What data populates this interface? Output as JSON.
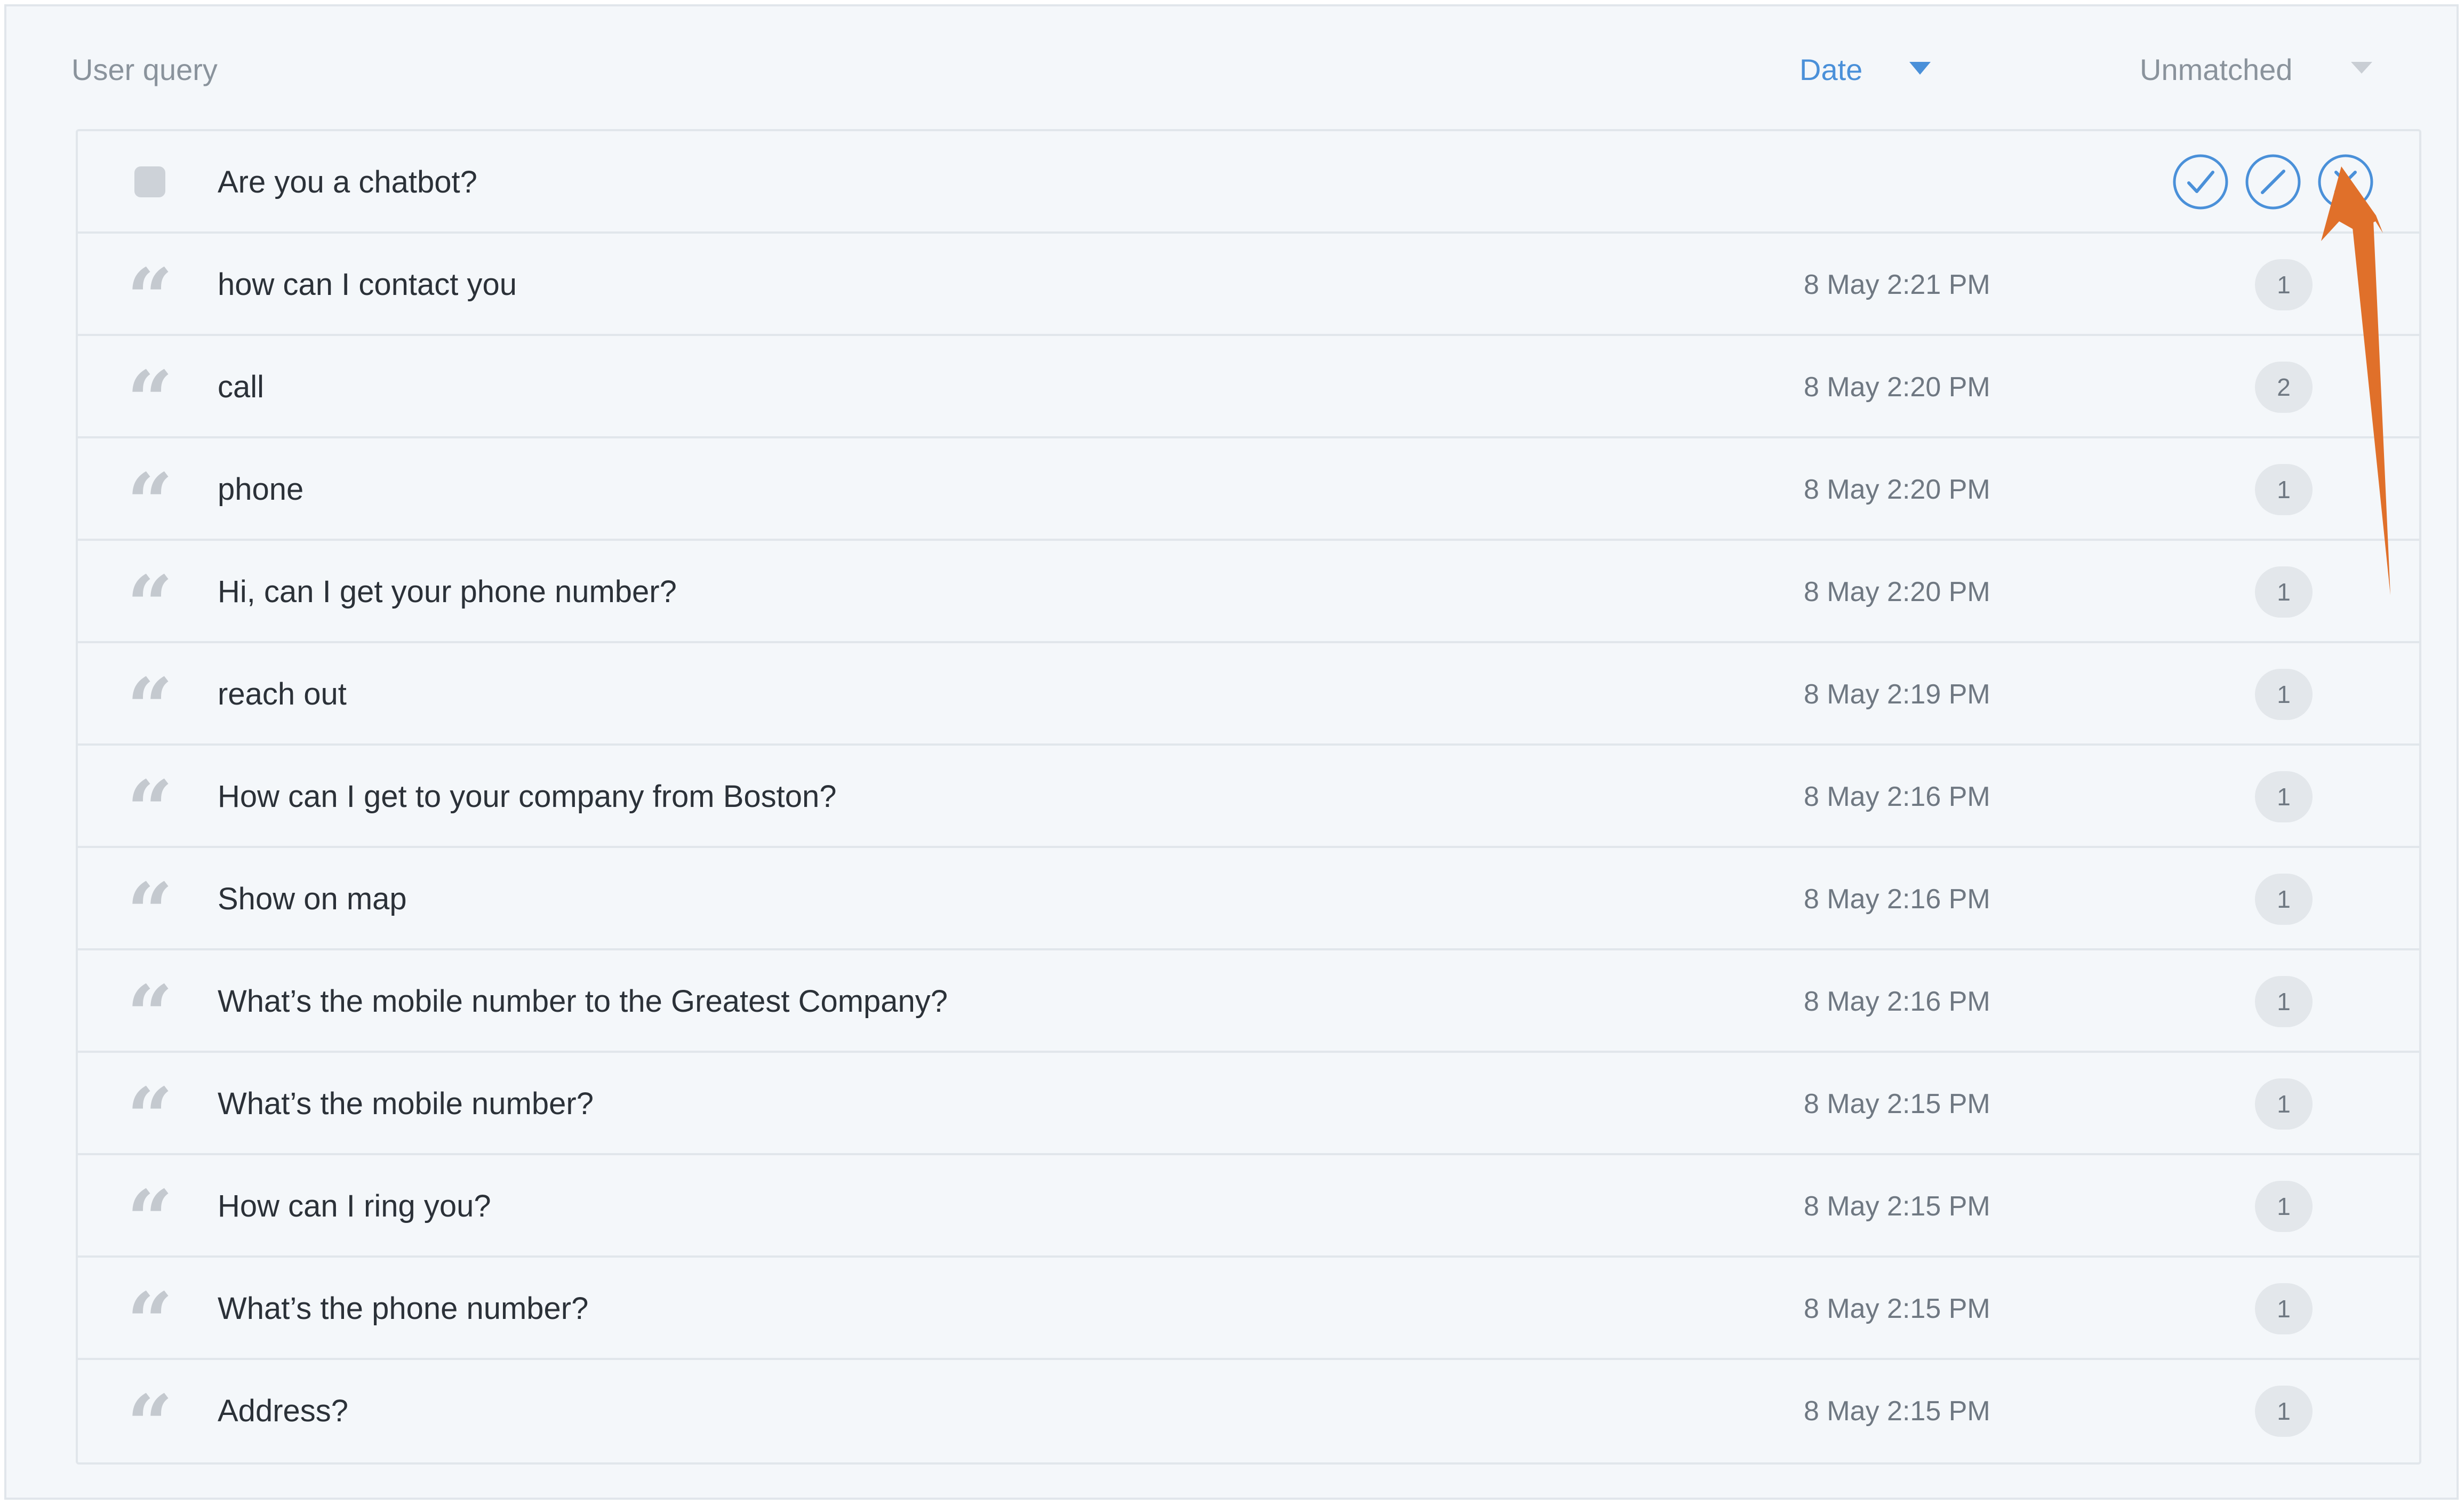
{
  "header": {
    "query_label": "User query",
    "date_label": "Date",
    "status_label": "Unmatched"
  },
  "selected_row": {
    "text": "Are you a chatbot?",
    "actions": [
      "check-icon",
      "slash-icon",
      "x-icon"
    ]
  },
  "rows": [
    {
      "text": "how can I contact you",
      "date": "8 May 2:21 PM",
      "count": "1"
    },
    {
      "text": "call",
      "date": "8 May 2:20 PM",
      "count": "2"
    },
    {
      "text": "phone",
      "date": "8 May 2:20 PM",
      "count": "1"
    },
    {
      "text": "Hi, can I get your phone number?",
      "date": "8 May 2:20 PM",
      "count": "1"
    },
    {
      "text": "reach out",
      "date": "8 May 2:19 PM",
      "count": "1"
    },
    {
      "text": "How can I get to your company from Boston?",
      "date": "8 May 2:16 PM",
      "count": "1"
    },
    {
      "text": "Show on map",
      "date": "8 May 2:16 PM",
      "count": "1"
    },
    {
      "text": "What’s the mobile number to the Greatest Company?",
      "date": "8 May 2:16 PM",
      "count": "1"
    },
    {
      "text": "What’s the mobile number?",
      "date": "8 May 2:15 PM",
      "count": "1"
    },
    {
      "text": "How can I ring you?",
      "date": "8 May 2:15 PM",
      "count": "1"
    },
    {
      "text": "What’s the phone number?",
      "date": "8 May 2:15 PM",
      "count": "1"
    },
    {
      "text": "Address?",
      "date": "8 May 2:15 PM",
      "count": "1"
    }
  ],
  "row_icon": "quote-icon",
  "colors": {
    "accent": "#4a90d9",
    "annotation_arrow": "#e0702a",
    "panel_background": "#f4f7fa",
    "border": "#e1e6eb"
  }
}
